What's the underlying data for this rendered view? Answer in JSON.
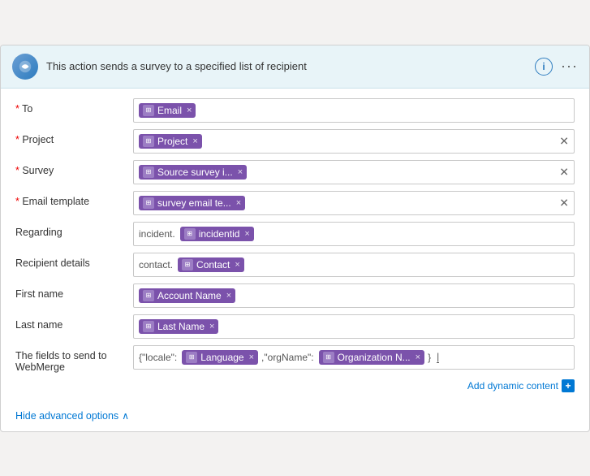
{
  "header": {
    "description": "This action sends a survey to a specified list of recipient",
    "info_icon_label": "i",
    "more_icon_label": "···"
  },
  "fields": [
    {
      "id": "to",
      "label": "* To",
      "required": true,
      "tokens": [
        {
          "text": "Email",
          "prefix": ""
        }
      ],
      "has_clear": false
    },
    {
      "id": "project",
      "label": "* Project",
      "required": true,
      "tokens": [
        {
          "text": "Project",
          "prefix": ""
        }
      ],
      "has_clear": true
    },
    {
      "id": "survey",
      "label": "* Survey",
      "required": true,
      "tokens": [
        {
          "text": "Source survey i...",
          "prefix": ""
        }
      ],
      "has_clear": true
    },
    {
      "id": "email-template",
      "label": "* Email template",
      "required": true,
      "tokens": [
        {
          "text": "survey email te...",
          "prefix": ""
        }
      ],
      "has_clear": true
    },
    {
      "id": "regarding",
      "label": "Regarding",
      "required": false,
      "tokens": [
        {
          "text": "incidentid",
          "prefix": "incident."
        }
      ],
      "has_clear": false
    },
    {
      "id": "recipient-details",
      "label": "Recipient details",
      "required": false,
      "tokens": [
        {
          "text": "Contact",
          "prefix": "contact."
        }
      ],
      "has_clear": false
    },
    {
      "id": "first-name",
      "label": "First name",
      "required": false,
      "tokens": [
        {
          "text": "Account Name",
          "prefix": ""
        }
      ],
      "has_clear": false
    },
    {
      "id": "last-name",
      "label": "Last name",
      "required": false,
      "tokens": [
        {
          "text": "Last Name",
          "prefix": ""
        }
      ],
      "has_clear": false
    },
    {
      "id": "webmerge",
      "label": "The fields to send to WebMerge",
      "required": false,
      "prefix_text": "{\"locale\":",
      "tokens": [
        {
          "text": "Language",
          "prefix": ""
        },
        {
          "text": "Organization N...",
          "prefix": ",\"orgName\":"
        }
      ],
      "suffix_text": "}|",
      "has_clear": false
    }
  ],
  "add_dynamic_label": "Add dynamic content",
  "hide_advanced_label": "Hide advanced options"
}
